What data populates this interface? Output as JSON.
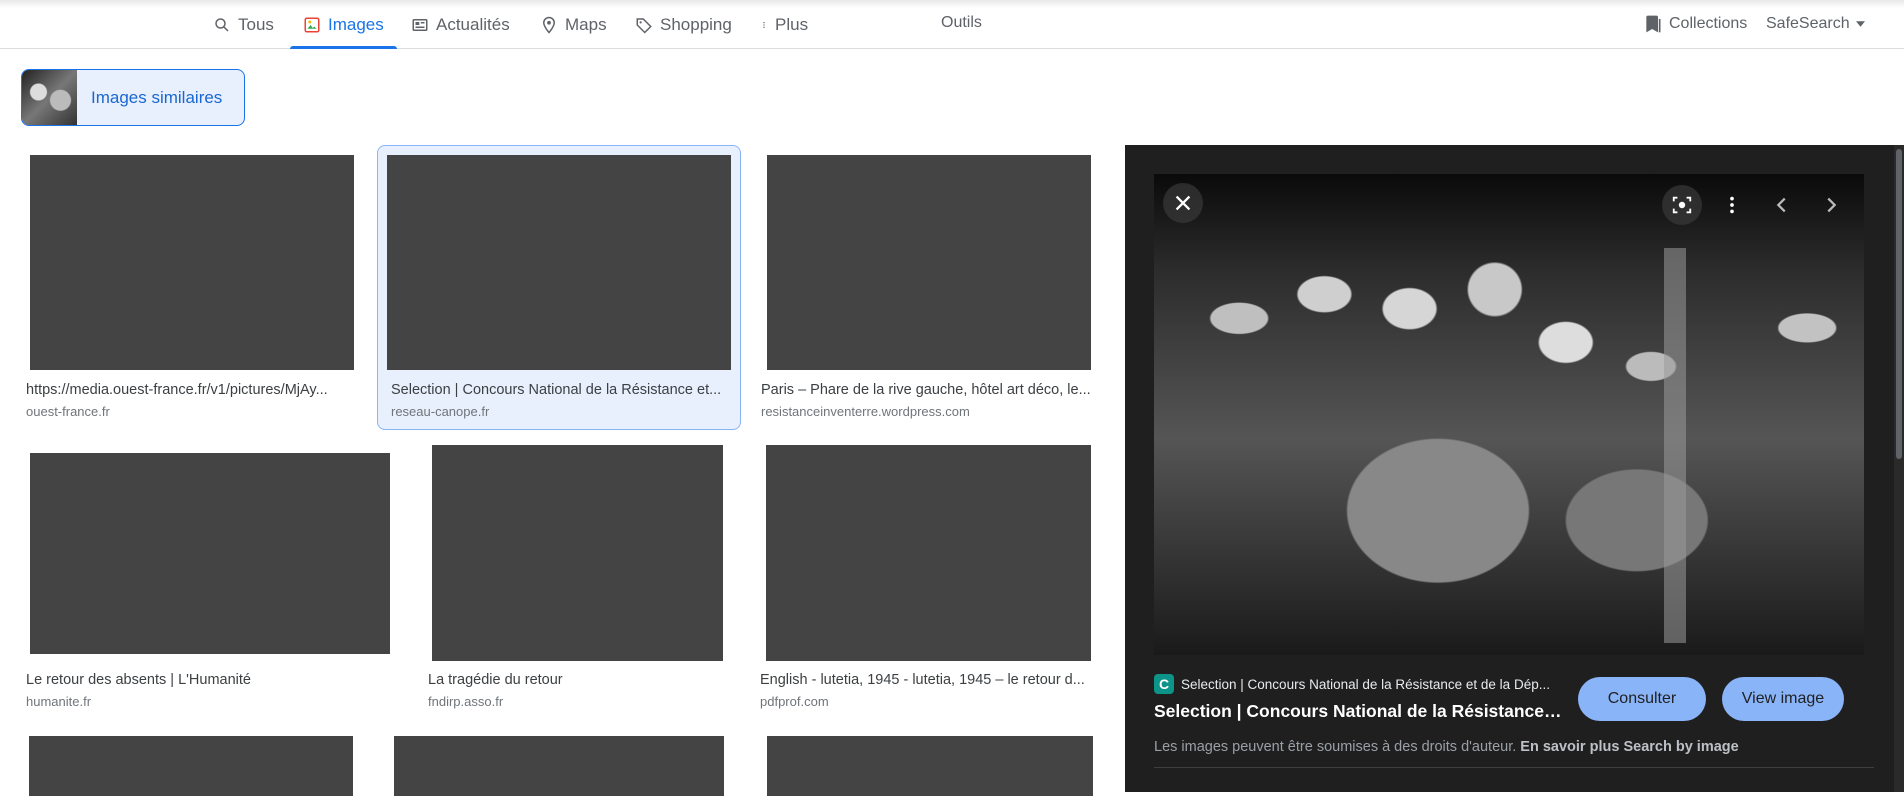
{
  "tabs": [
    {
      "label": "Tous",
      "icon": "search-icon"
    },
    {
      "label": "Images",
      "icon": "images-icon"
    },
    {
      "label": "Actualités",
      "icon": "news-icon"
    },
    {
      "label": "Maps",
      "icon": "map-pin-icon"
    },
    {
      "label": "Shopping",
      "icon": "tag-icon"
    },
    {
      "label": "Plus",
      "icon": "more-vertical-icon"
    }
  ],
  "tools_label": "Outils",
  "collections_label": "Collections",
  "safesearch_label": "SafeSearch",
  "similar_images_label": "Images similaires",
  "results": [
    {
      "title": "https://media.ouest-france.fr/v1/pictures/MjAy...",
      "source": "ouest-france.fr"
    },
    {
      "title": "Selection | Concours National de la Résistance et...",
      "source": "reseau-canope.fr"
    },
    {
      "title": "Paris – Phare de la rive gauche, hôtel art déco, le...",
      "source": "resistanceinventerre.wordpress.com"
    },
    {
      "title": "Le retour des absents | L'Humanité",
      "source": "humanite.fr"
    },
    {
      "title": "La tragédie du retour",
      "source": "fndirp.asso.fr"
    },
    {
      "title": "English - lutetia, 1945 - lutetia, 1945 – le retour d...",
      "source": "pdfprof.com"
    }
  ],
  "preview": {
    "source_favicon": "C",
    "source_name": "Selection | Concours National de la Résistance et de la Dép...",
    "title": "Selection | Concours National de la Résistance et...",
    "consult_label": "Consulter",
    "view_image_label": "View image",
    "copyright_text": "Les images peuvent être soumises à des droits d'auteur.",
    "learn_more_label": "En savoir plus",
    "search_by_image_label": "Search by image"
  },
  "colors": {
    "accent": "#1a73e8",
    "panel_bg": "#1f1f1f",
    "button_bg": "#8ab4f8"
  }
}
